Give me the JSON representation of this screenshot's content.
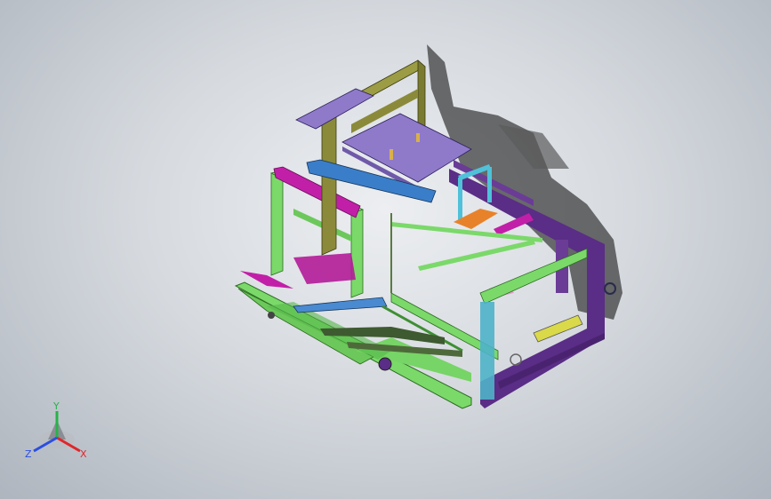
{
  "viewport": {
    "background_top": "#eceef1",
    "background_bottom": "#aeb5be"
  },
  "model": {
    "description_icon": "cad-machine-assembly",
    "colors": {
      "frame_green": "#7bd96a",
      "frame_purple": "#5a2d86",
      "gantry_olive": "#8a8a3a",
      "plate_lavender": "#8f7ac9",
      "magenta": "#c21fa8",
      "blue": "#3a7ec9",
      "orange": "#e8822a",
      "pink": "#e69ad2",
      "cyan": "#4fc1d9",
      "shadow": "#2a2a2a"
    }
  },
  "triad": {
    "x_label": "X",
    "y_label": "Y",
    "z_label": "Z",
    "x_color": "#e0262b",
    "y_color": "#27b24a",
    "z_color": "#2b4fe0"
  }
}
